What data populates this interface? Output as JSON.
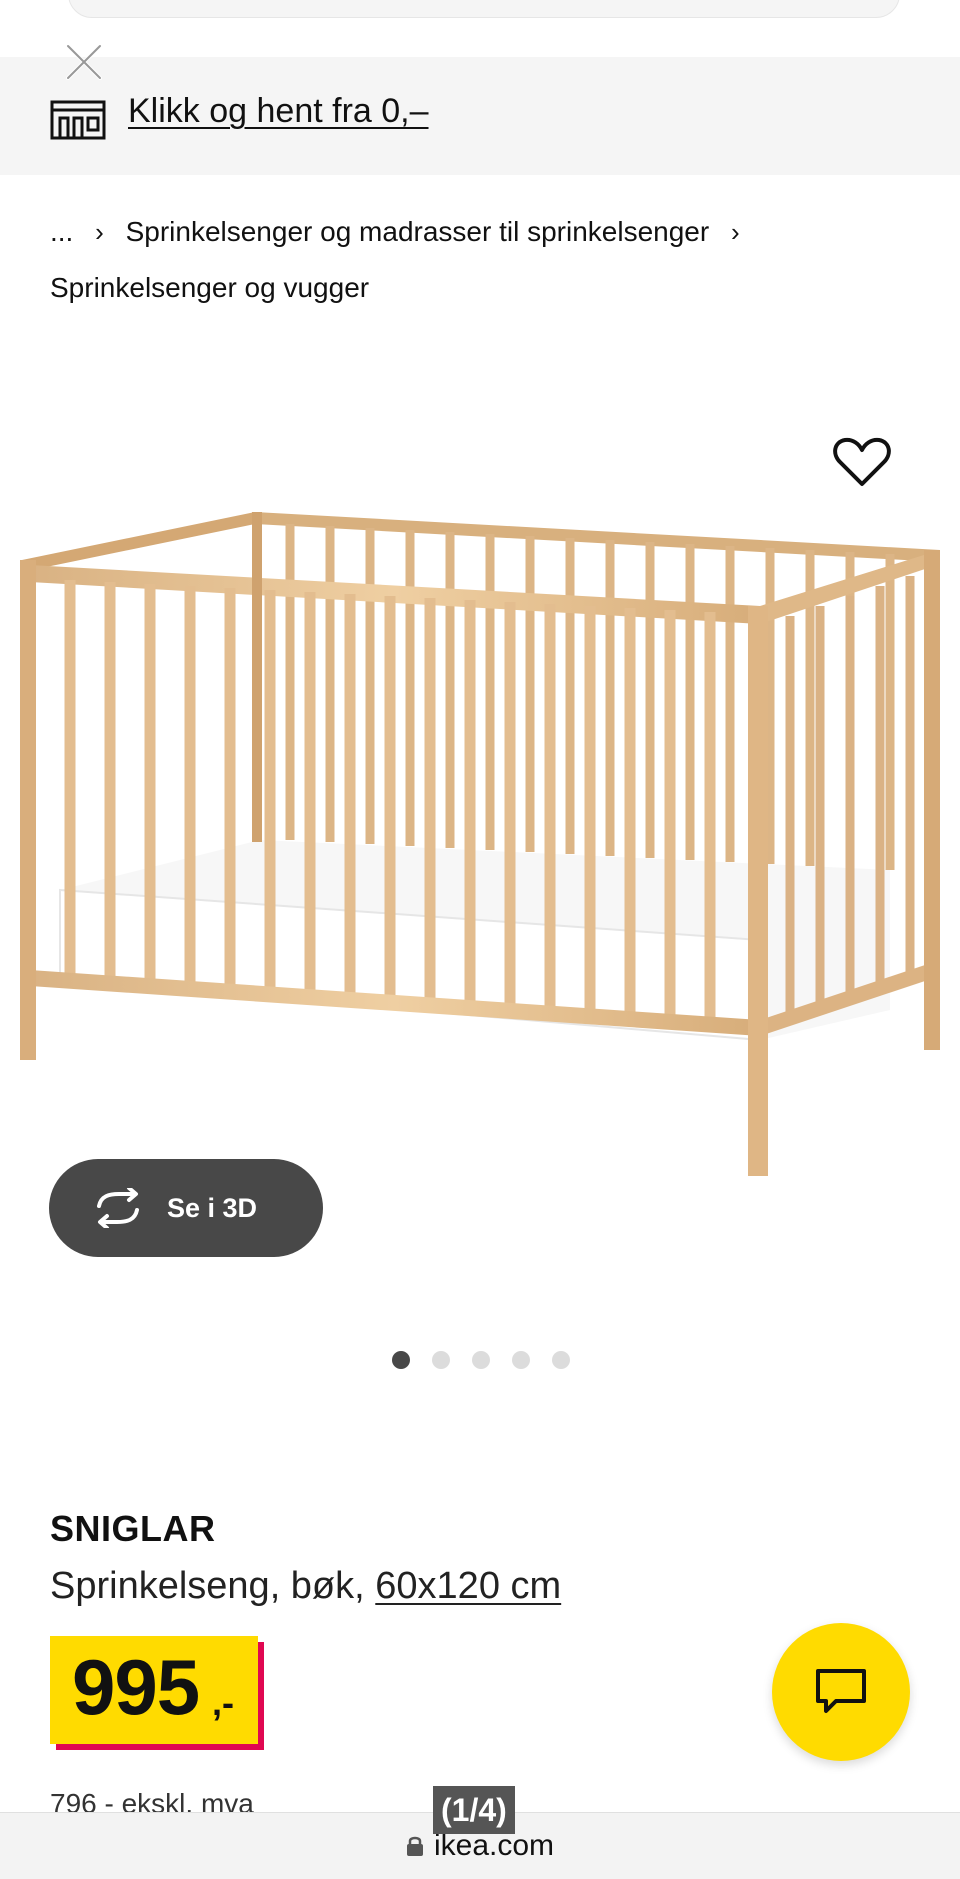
{
  "banner": {
    "link_text": "Klikk og hent fra 0,–"
  },
  "breadcrumb": {
    "ellipsis": "...",
    "crumbs": [
      "Sprinkelsenger og madrasser til sprinkelsenger",
      "Sprinkelsenger og vugger"
    ]
  },
  "gallery": {
    "view_3d_label": "Se i 3D",
    "dots_total": 5,
    "dots_active_index": 0
  },
  "product": {
    "name": "SNIGLAR",
    "description": "Sprinkelseng, bøk,",
    "size": "60x120 cm",
    "price": "995",
    "price_suffix": ",-",
    "price_ex_vat": "796 - ekskl. mva"
  },
  "browser": {
    "url": "ikea.com",
    "page_counter": "(1/4)"
  },
  "colors": {
    "ikea_yellow": "#ffdb00",
    "price_shadow_red": "#e00751",
    "dark_button": "#484848",
    "banner_bg": "#f5f5f5"
  }
}
